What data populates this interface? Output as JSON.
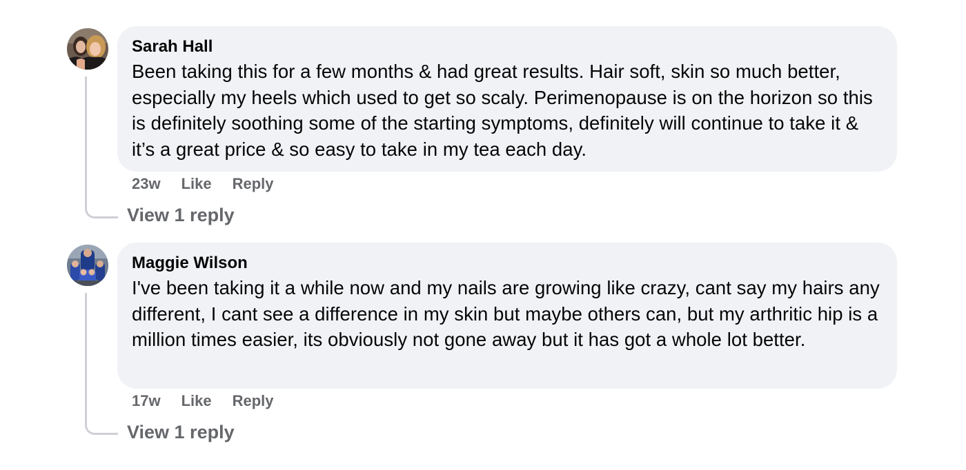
{
  "comments": [
    {
      "author": "Sarah Hall",
      "text": "Been taking this for a few months & had great results. Hair soft, skin so much better, especially my heels which used to get so scaly. Perimenopause is on the horizon so this is definitely soothing some of the starting symptoms, definitely will continue to take it & it’s a great price & so easy to take in my tea each day.",
      "time": "23w",
      "like_label": "Like",
      "reply_label": "Reply",
      "view_replies_label": "View 1 reply",
      "avatar_icon": "profile-photo-two-women"
    },
    {
      "author": "Maggie Wilson",
      "text": "I've been taking it a while now and my nails are growing like crazy, cant say my hairs any different, I cant see a difference in my skin but maybe others can, but my arthritic hip is a million times easier, its obviously not gone away but it has got a whole lot better.",
      "time": "17w",
      "like_label": "Like",
      "reply_label": "Reply",
      "view_replies_label": "View 1 reply",
      "avatar_icon": "profile-photo-family-group"
    }
  ],
  "colors": {
    "bubble_bg": "#f0f2f5",
    "text_primary": "#050505",
    "text_secondary": "#65676b",
    "connector": "#ced0d4"
  }
}
